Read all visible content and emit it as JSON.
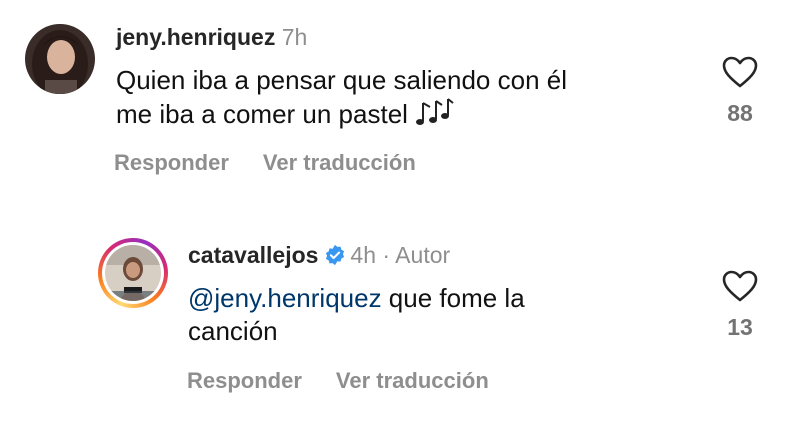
{
  "comments": [
    {
      "username": "jeny.henriquez",
      "time": "7h",
      "author_tag": "",
      "mention": "",
      "text_line1": "Quien iba a pensar que saliendo con él",
      "text_line2": "me iba a comer un pastel",
      "emoji": "music-notes-icon",
      "reply_label": "Responder",
      "translate_label": "Ver traducción",
      "likes": "88",
      "has_story_ring": false
    },
    {
      "username": "catavallejos",
      "time": "4h",
      "author_tag": "· Autor",
      "mention": "@jeny.henriquez",
      "text_line1": " que fome la",
      "text_line2": "canción",
      "verified": true,
      "reply_label": "Responder",
      "translate_label": "Ver traducción",
      "likes": "13",
      "has_story_ring": true
    }
  ],
  "colors": {
    "username": "#262626",
    "meta": "#8e8e8e",
    "mention": "#00376b",
    "verified": "#3897f0",
    "background": "#ffffff"
  }
}
